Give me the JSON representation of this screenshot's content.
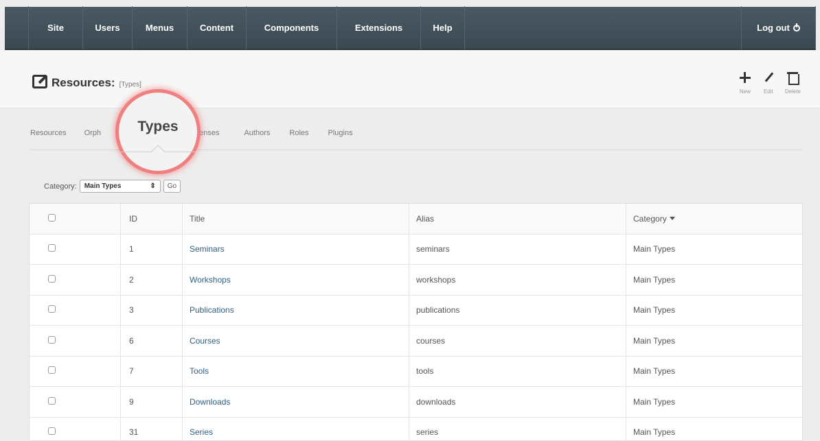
{
  "nav": {
    "items": [
      "Site",
      "Users",
      "Menus",
      "Content",
      "Components",
      "Extensions",
      "Help"
    ],
    "logout": "Log out"
  },
  "header": {
    "title": "Resources:",
    "subtitle": "[Types]",
    "toolbar": {
      "new": "New",
      "edit": "Edit",
      "delete": "Delete"
    }
  },
  "subtabs": [
    "Resources",
    "Orph",
    "Licenses",
    "Authors",
    "Roles",
    "Plugins"
  ],
  "magnified_tab": "Types",
  "filter": {
    "label": "Category:",
    "selected": "Main Types",
    "go": "Go"
  },
  "table": {
    "headers": {
      "id": "ID",
      "title": "Title",
      "alias": "Alias",
      "category": "Category"
    },
    "rows": [
      {
        "id": "1",
        "title": "Seminars",
        "alias": "seminars",
        "category": "Main Types"
      },
      {
        "id": "2",
        "title": "Workshops",
        "alias": "workshops",
        "category": "Main Types"
      },
      {
        "id": "3",
        "title": "Publications",
        "alias": "publications",
        "category": "Main Types"
      },
      {
        "id": "6",
        "title": "Courses",
        "alias": "courses",
        "category": "Main Types"
      },
      {
        "id": "7",
        "title": "Tools",
        "alias": "tools",
        "category": "Main Types"
      },
      {
        "id": "9",
        "title": "Downloads",
        "alias": "downloads",
        "category": "Main Types"
      },
      {
        "id": "31",
        "title": "Series",
        "alias": "series",
        "category": "Main Types"
      }
    ]
  }
}
